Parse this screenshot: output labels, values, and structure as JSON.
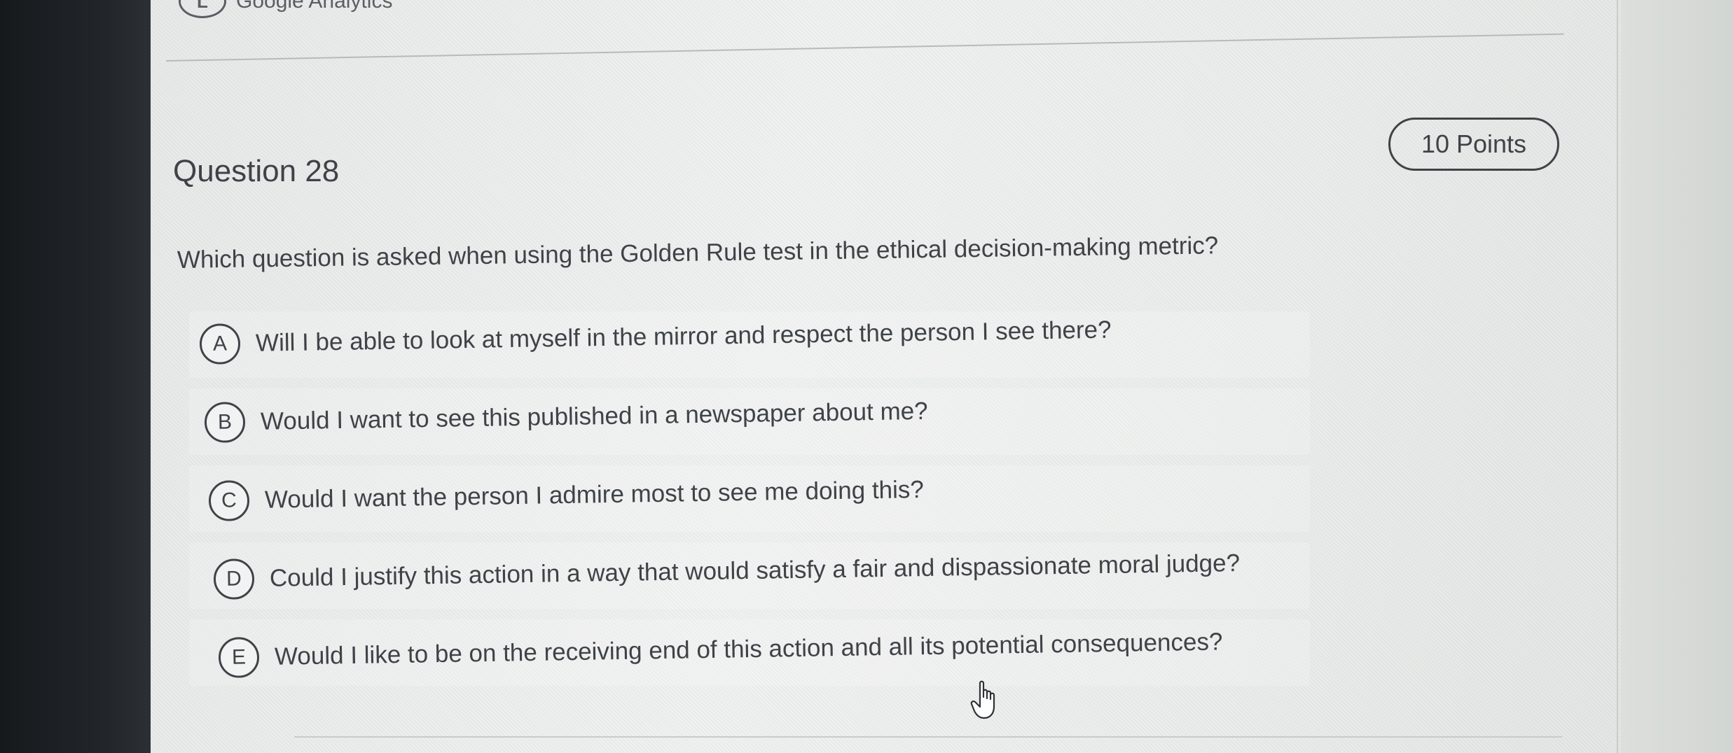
{
  "header": {
    "crumb_letter": "L",
    "crumb_text": "Google Analytics"
  },
  "question": {
    "title": "Question 28",
    "points": "10 Points",
    "prompt": "Which question is asked when using the Golden Rule test in the ethical decision-making metric?"
  },
  "options": [
    {
      "letter": "A",
      "text": "Will I be able to look at myself in the mirror and respect the person I see there?"
    },
    {
      "letter": "B",
      "text": "Would I want to see this published in a newspaper about me?"
    },
    {
      "letter": "C",
      "text": "Would I want the person I admire most to see me doing this?"
    },
    {
      "letter": "D",
      "text": "Could I justify this action in a way that would satisfy a fair and dispassionate moral judge?"
    },
    {
      "letter": "E",
      "text": "Would I like to be on the receiving end of this action and all its potential consequences?"
    }
  ],
  "cursor_icon": "hand-pointer-icon"
}
